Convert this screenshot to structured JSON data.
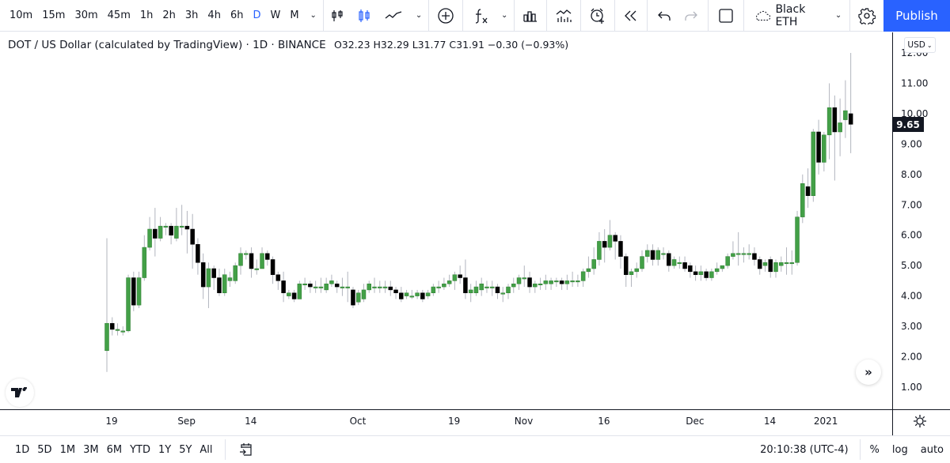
{
  "toolbar": {
    "timeframes": [
      "10m",
      "15m",
      "30m",
      "45m",
      "1h",
      "2h",
      "3h",
      "4h",
      "6h",
      "D",
      "W",
      "M"
    ],
    "active_timeframe": "D",
    "layout_name": "Black ETH",
    "publish_label": "Publish",
    "icons": [
      "bar-style-icon",
      "candles-icon",
      "line-style-icon",
      "chevron-down-icon",
      "add-symbol-icon",
      "indicators-icon",
      "chevron-down-icon",
      "templates-icon",
      "compare-icon",
      "alert-icon",
      "replay-icon",
      "undo-icon",
      "redo-icon",
      "select-layout-icon",
      "cloud-icon",
      "settings-icon",
      "fullscreen-icon",
      "camera-icon"
    ]
  },
  "legend": {
    "title": "DOT / US Dollar (calculated by TradingView) · 1D · BINANCE",
    "ohlc": "O32.23 H32.29 L31.77 C31.91 −0.30 (−0.93%)"
  },
  "currency_button": "USD",
  "last_price_label": "9.65",
  "bottom": {
    "ranges": [
      "1D",
      "5D",
      "1M",
      "3M",
      "6M",
      "YTD",
      "1Y",
      "5Y",
      "All"
    ],
    "clock": "20:10:38 (UTC-4)",
    "options": [
      "%",
      "log",
      "auto"
    ]
  },
  "colors": {
    "up": "#43a047",
    "down": "#000000",
    "wick": "#b2b5be",
    "accent": "#2962ff",
    "grid": "#e0e3eb",
    "text": "#131722"
  },
  "chart_data": {
    "type": "candlestick",
    "symbol": "DOT / US Dollar",
    "interval": "1D",
    "exchange": "BINANCE",
    "y_axis": {
      "ticks": [
        "1.00",
        "2.00",
        "3.00",
        "4.00",
        "5.00",
        "6.00",
        "7.00",
        "8.00",
        "9.00",
        "10.00",
        "11.00",
        "12.00"
      ],
      "range": [
        0.3,
        12.0
      ]
    },
    "x_axis": {
      "ticks": [
        "19",
        "Sep",
        "14",
        "Oct",
        "19",
        "Nov",
        "16",
        "Dec",
        "14",
        "2021"
      ]
    },
    "x_tick_candle_index": [
      0,
      14,
      26,
      46,
      64,
      77,
      92,
      109,
      123,
      141
    ],
    "last_price": 9.65,
    "candles": [
      [
        2.2,
        3.1,
        1.5,
        5.9
      ],
      [
        3.1,
        2.9,
        2.7,
        3.3
      ],
      [
        2.9,
        2.9,
        2.7,
        3.1
      ],
      [
        2.85,
        2.85,
        2.7,
        3.0
      ],
      [
        2.85,
        4.6,
        2.8,
        4.7
      ],
      [
        4.6,
        3.7,
        3.5,
        4.8
      ],
      [
        3.7,
        4.6,
        3.6,
        4.8
      ],
      [
        4.6,
        5.6,
        4.5,
        6.0
      ],
      [
        5.6,
        6.2,
        5.5,
        6.6
      ],
      [
        6.2,
        5.9,
        5.3,
        6.9
      ],
      [
        5.9,
        6.3,
        5.8,
        6.6
      ],
      [
        6.3,
        6.3,
        6.0,
        6.4
      ],
      [
        6.3,
        6.0,
        5.7,
        6.4
      ],
      [
        5.9,
        6.3,
        5.8,
        6.9
      ],
      [
        6.3,
        6.3,
        6.0,
        7.0
      ],
      [
        6.3,
        6.2,
        5.4,
        6.8
      ],
      [
        6.2,
        5.7,
        4.9,
        6.7
      ],
      [
        5.7,
        5.1,
        4.7,
        5.9
      ],
      [
        5.1,
        4.3,
        3.9,
        5.4
      ],
      [
        4.3,
        4.9,
        3.6,
        5.1
      ],
      [
        4.9,
        4.6,
        4.2,
        5.0
      ],
      [
        4.6,
        4.1,
        4.0,
        4.9
      ],
      [
        4.1,
        4.7,
        4.0,
        4.9
      ],
      [
        4.5,
        4.6,
        4.3,
        4.8
      ],
      [
        4.5,
        5.0,
        4.4,
        5.1
      ],
      [
        5.0,
        5.4,
        4.7,
        5.6
      ],
      [
        5.4,
        5.4,
        5.2,
        5.5
      ],
      [
        5.4,
        4.9,
        4.6,
        5.6
      ],
      [
        4.9,
        4.9,
        4.7,
        5.2
      ],
      [
        4.9,
        5.4,
        4.9,
        5.6
      ],
      [
        5.4,
        5.2,
        5.0,
        5.5
      ],
      [
        5.2,
        4.7,
        4.4,
        5.3
      ],
      [
        4.7,
        4.5,
        4.2,
        4.8
      ],
      [
        4.5,
        4.1,
        3.8,
        4.8
      ],
      [
        4.0,
        4.1,
        3.9,
        4.2
      ],
      [
        4.1,
        3.9,
        3.8,
        4.2
      ],
      [
        3.9,
        4.4,
        3.9,
        4.5
      ],
      [
        4.4,
        4.4,
        4.2,
        4.6
      ],
      [
        4.4,
        4.3,
        4.1,
        4.5
      ],
      [
        4.3,
        4.3,
        4.1,
        4.5
      ],
      [
        4.3,
        4.3,
        4.1,
        4.6
      ],
      [
        4.2,
        4.4,
        4.1,
        4.6
      ],
      [
        4.4,
        4.5,
        4.3,
        4.7
      ],
      [
        4.4,
        4.3,
        4.1,
        4.5
      ],
      [
        4.3,
        4.3,
        4.0,
        4.6
      ],
      [
        4.3,
        4.3,
        3.8,
        4.8
      ],
      [
        4.2,
        3.7,
        3.6,
        4.3
      ],
      [
        3.8,
        4.1,
        3.7,
        4.2
      ],
      [
        3.9,
        4.2,
        3.8,
        4.4
      ],
      [
        4.2,
        4.4,
        4.1,
        4.5
      ],
      [
        4.3,
        4.3,
        4.1,
        4.6
      ],
      [
        4.3,
        4.3,
        4.1,
        4.5
      ],
      [
        4.3,
        4.3,
        4.1,
        4.5
      ],
      [
        4.3,
        4.2,
        4.0,
        4.5
      ],
      [
        4.2,
        4.1,
        3.9,
        4.3
      ],
      [
        4.1,
        3.9,
        3.8,
        4.3
      ],
      [
        4.0,
        4.1,
        3.9,
        4.2
      ],
      [
        4.0,
        4.0,
        3.9,
        4.2
      ],
      [
        4.0,
        4.1,
        3.9,
        4.2
      ],
      [
        4.1,
        3.9,
        3.8,
        4.2
      ],
      [
        4.0,
        4.1,
        3.9,
        4.2
      ],
      [
        4.1,
        4.3,
        4.0,
        4.4
      ],
      [
        4.3,
        4.3,
        4.1,
        4.5
      ],
      [
        4.3,
        4.4,
        4.2,
        4.6
      ],
      [
        4.4,
        4.5,
        4.3,
        4.7
      ],
      [
        4.5,
        4.7,
        4.2,
        4.8
      ],
      [
        4.7,
        4.6,
        4.4,
        5.0
      ],
      [
        4.6,
        4.1,
        3.9,
        5.2
      ],
      [
        4.1,
        4.2,
        3.8,
        4.4
      ],
      [
        4.1,
        4.3,
        4.0,
        4.5
      ],
      [
        4.2,
        4.4,
        4.0,
        4.6
      ],
      [
        4.3,
        4.3,
        4.1,
        4.5
      ],
      [
        4.3,
        4.3,
        4.0,
        4.5
      ],
      [
        4.3,
        4.1,
        3.9,
        4.4
      ],
      [
        4.1,
        4.1,
        3.8,
        4.3
      ],
      [
        4.1,
        4.3,
        3.9,
        4.4
      ],
      [
        4.3,
        4.4,
        4.1,
        4.6
      ],
      [
        4.4,
        4.6,
        4.2,
        4.7
      ],
      [
        4.6,
        4.6,
        4.3,
        5.0
      ],
      [
        4.6,
        4.3,
        4.1,
        4.8
      ],
      [
        4.3,
        4.4,
        4.1,
        4.5
      ],
      [
        4.4,
        4.4,
        4.2,
        4.6
      ],
      [
        4.4,
        4.5,
        4.2,
        4.7
      ],
      [
        4.4,
        4.5,
        4.2,
        4.6
      ],
      [
        4.5,
        4.5,
        4.3,
        4.6
      ],
      [
        4.5,
        4.4,
        4.2,
        4.6
      ],
      [
        4.4,
        4.5,
        4.2,
        4.7
      ],
      [
        4.5,
        4.5,
        4.3,
        4.8
      ],
      [
        4.5,
        4.5,
        4.3,
        4.7
      ],
      [
        4.5,
        4.8,
        4.3,
        4.9
      ],
      [
        4.8,
        4.9,
        4.6,
        5.3
      ],
      [
        4.9,
        5.2,
        4.7,
        5.6
      ],
      [
        5.2,
        5.8,
        5.0,
        6.1
      ],
      [
        5.8,
        5.6,
        5.1,
        6.2
      ],
      [
        5.6,
        6.0,
        5.5,
        6.5
      ],
      [
        6.0,
        5.8,
        5.2,
        6.1
      ],
      [
        5.8,
        5.3,
        4.9,
        6.0
      ],
      [
        5.3,
        4.7,
        4.3,
        5.4
      ],
      [
        4.7,
        4.8,
        4.3,
        4.9
      ],
      [
        4.8,
        4.9,
        4.6,
        5.1
      ],
      [
        4.9,
        5.3,
        4.8,
        5.5
      ],
      [
        5.3,
        5.5,
        5.1,
        5.7
      ],
      [
        5.5,
        5.2,
        5.0,
        5.7
      ],
      [
        5.2,
        5.5,
        5.0,
        5.6
      ],
      [
        5.4,
        5.4,
        5.2,
        5.6
      ],
      [
        5.4,
        5.0,
        4.8,
        5.5
      ],
      [
        5.0,
        5.2,
        4.9,
        5.3
      ],
      [
        5.1,
        5.1,
        4.9,
        5.3
      ],
      [
        5.1,
        4.9,
        4.8,
        5.3
      ],
      [
        5.0,
        4.8,
        4.6,
        5.1
      ],
      [
        4.8,
        4.7,
        4.5,
        5.0
      ],
      [
        4.7,
        4.8,
        4.5,
        5.0
      ],
      [
        4.8,
        4.6,
        4.5,
        4.9
      ],
      [
        4.6,
        4.8,
        4.5,
        4.9
      ],
      [
        4.8,
        4.9,
        4.7,
        5.1
      ],
      [
        4.9,
        5.0,
        4.8,
        5.0
      ],
      [
        5.0,
        5.3,
        4.9,
        5.4
      ],
      [
        5.3,
        5.4,
        5.2,
        5.8
      ],
      [
        5.4,
        5.4,
        5.0,
        6.1
      ],
      [
        5.4,
        5.4,
        5.1,
        5.6
      ],
      [
        5.4,
        5.4,
        5.2,
        5.7
      ],
      [
        5.4,
        5.2,
        5.0,
        5.6
      ],
      [
        5.2,
        4.9,
        4.7,
        5.3
      ],
      [
        5.0,
        5.1,
        4.8,
        5.2
      ],
      [
        5.2,
        4.8,
        4.6,
        5.3
      ],
      [
        4.8,
        5.1,
        4.6,
        5.2
      ],
      [
        5.0,
        5.1,
        4.8,
        5.3
      ],
      [
        5.1,
        5.1,
        4.7,
        5.6
      ],
      [
        5.1,
        5.1,
        4.7,
        5.5
      ],
      [
        5.1,
        6.6,
        5.0,
        6.8
      ],
      [
        6.6,
        7.7,
        6.4,
        8.0
      ],
      [
        7.6,
        7.3,
        6.9,
        8.2
      ],
      [
        7.3,
        9.4,
        7.1,
        9.5
      ],
      [
        9.4,
        8.4,
        8.0,
        9.8
      ],
      [
        8.4,
        9.3,
        8.1,
        9.4
      ],
      [
        9.3,
        10.2,
        8.5,
        11.0
      ],
      [
        10.2,
        9.4,
        7.8,
        10.6
      ],
      [
        9.4,
        9.7,
        8.6,
        10.5
      ],
      [
        9.8,
        10.1,
        9.2,
        11.1
      ],
      [
        10.0,
        9.65,
        8.7,
        12.0
      ]
    ]
  }
}
